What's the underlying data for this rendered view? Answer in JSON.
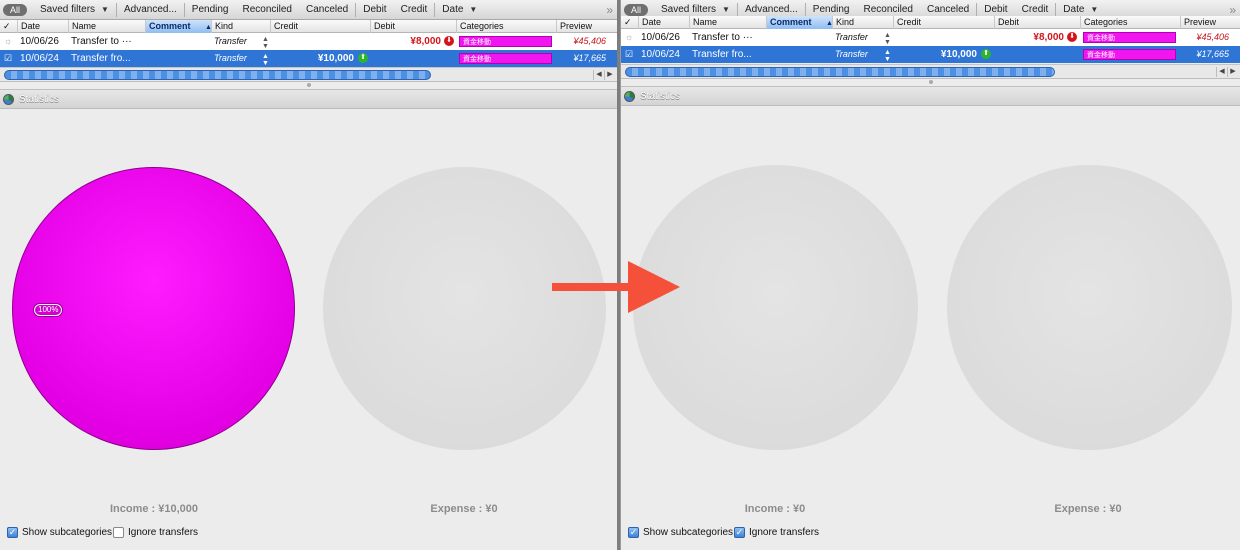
{
  "toolbar": {
    "all": "All",
    "saved_filters": "Saved filters",
    "advanced": "Advanced...",
    "pending": "Pending",
    "reconciled": "Reconciled",
    "canceled": "Canceled",
    "debit": "Debit",
    "credit": "Credit",
    "date": "Date"
  },
  "columns": {
    "check": "✓",
    "date": "Date",
    "name": "Name",
    "comment": "Comment",
    "kind": "Kind",
    "credit": "Credit",
    "debit": "Debit",
    "categories": "Categories",
    "preview": "Preview"
  },
  "rows": [
    {
      "date": "10/06/26",
      "name": "Transfer to ···",
      "kind": "Transfer",
      "debit": "¥8,000",
      "category": "資金移動",
      "preview": "¥45,406"
    },
    {
      "date": "10/06/24",
      "name": "Transfer fro...",
      "kind": "Transfer",
      "credit": "¥10,000",
      "category": "資金移動",
      "preview": "¥17,665"
    }
  ],
  "stats": {
    "title": "Statistics"
  },
  "left": {
    "pct": "100%",
    "income": "Income : ¥10,000",
    "expense": "Expense : ¥0",
    "show_subcategories": "Show subcategories",
    "ignore_transfers": "Ignore transfers",
    "show_subcategories_checked": true,
    "ignore_transfers_checked": false
  },
  "right": {
    "income": "Income : ¥0",
    "expense": "Expense : ¥0",
    "show_subcategories": "Show subcategories",
    "ignore_transfers": "Ignore transfers",
    "show_subcategories_checked": true,
    "ignore_transfers_checked": true
  },
  "colors": {
    "accent_selection": "#2f75d6",
    "income_pie": "#f116ef",
    "empty_pie": "#dddddd",
    "arrow": "#f4503a"
  }
}
